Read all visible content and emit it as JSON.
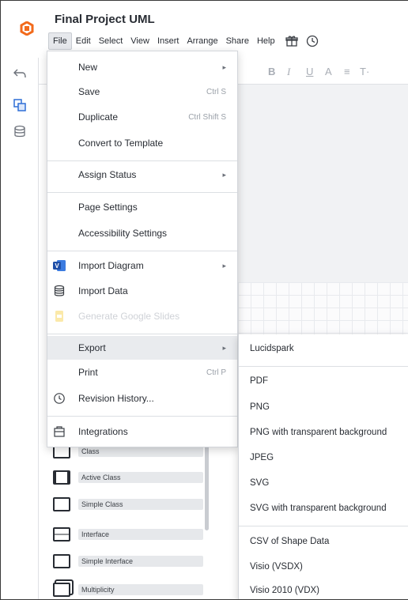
{
  "doc": {
    "title": "Final Project UML"
  },
  "menubar": {
    "items": [
      "File",
      "Edit",
      "Select",
      "View",
      "Insert",
      "Arrange",
      "Share",
      "Help"
    ],
    "active": "File"
  },
  "toolbar": {
    "glyphs": [
      "B",
      "I",
      "U",
      "A",
      "≡",
      "T·"
    ]
  },
  "file_menu": {
    "items": [
      {
        "label": "New",
        "shortcut": "",
        "submenu": true
      },
      {
        "label": "Save",
        "shortcut": "Ctrl S",
        "submenu": false
      },
      {
        "label": "Duplicate",
        "shortcut": "Ctrl Shift S",
        "submenu": false
      },
      {
        "label": "Convert to Template",
        "shortcut": "",
        "submenu": false
      },
      {
        "label": "Assign Status",
        "shortcut": "",
        "submenu": true
      },
      {
        "label": "Page Settings",
        "shortcut": "",
        "submenu": false
      },
      {
        "label": "Accessibility Settings",
        "shortcut": "",
        "submenu": false
      },
      {
        "label": "Import Diagram",
        "shortcut": "",
        "submenu": true,
        "icon": "visio-icon"
      },
      {
        "label": "Import Data",
        "shortcut": "",
        "submenu": false,
        "icon": "database-icon"
      },
      {
        "label": "Generate Google Slides",
        "shortcut": "",
        "submenu": false,
        "disabled": true,
        "icon": "slides-icon"
      },
      {
        "label": "Export",
        "shortcut": "",
        "submenu": true,
        "highlighted": true
      },
      {
        "label": "Print",
        "shortcut": "Ctrl P",
        "submenu": false
      },
      {
        "label": "Revision History...",
        "shortcut": "",
        "submenu": false,
        "icon": "clock-icon"
      },
      {
        "label": "Integrations",
        "shortcut": "",
        "submenu": false,
        "icon": "integrations-icon"
      }
    ]
  },
  "export_menu": {
    "items": [
      "Lucidspark",
      "PDF",
      "PNG",
      "PNG with transparent background",
      "JPEG",
      "SVG",
      "SVG with transparent background",
      "CSV of Shape Data",
      "Visio (VSDX)",
      "Visio 2010 (VDX)"
    ]
  },
  "shape_library": {
    "items": [
      "Class",
      "Active Class",
      "Simple Class",
      "Interface",
      "Simple Interface",
      "Multiplicity"
    ]
  },
  "colors": {
    "brand": "#f26a1b",
    "accent": "#2f6fd6",
    "highlight": "#e9ebee"
  }
}
